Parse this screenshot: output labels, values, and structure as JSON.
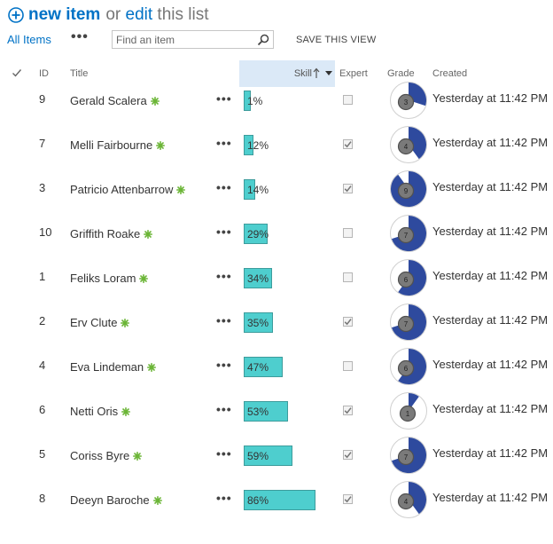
{
  "toolbar": {
    "new_item": "new item",
    "or_text": "or",
    "edit_link": "edit",
    "tail_text": "this list"
  },
  "view": {
    "all_items": "All Items",
    "more": "•••",
    "search_placeholder": "Find an item",
    "save_view": "SAVE THIS VIEW"
  },
  "columns": {
    "id": "ID",
    "title": "Title",
    "skill": "Skill",
    "expert": "Expert",
    "grade": "Grade",
    "created": "Created"
  },
  "colors": {
    "accent": "#0072c6",
    "skill_bar": "#4ecece",
    "grade_fill": "#2e4a9e",
    "new_badge": "#6bb536"
  },
  "rows": [
    {
      "id": "9",
      "title": "Gerald Scalera",
      "skill": 1,
      "skill_label": "1%",
      "expert": false,
      "grade": 3,
      "created": "Yesterday at 11:42 PM"
    },
    {
      "id": "7",
      "title": "Melli Fairbourne",
      "skill": 12,
      "skill_label": "12%",
      "expert": true,
      "grade": 4,
      "created": "Yesterday at 11:42 PM"
    },
    {
      "id": "3",
      "title": "Patricio Attenbarrow",
      "skill": 14,
      "skill_label": "14%",
      "expert": true,
      "grade": 9,
      "created": "Yesterday at 11:42 PM"
    },
    {
      "id": "10",
      "title": "Griffith Roake",
      "skill": 29,
      "skill_label": "29%",
      "expert": false,
      "grade": 7,
      "created": "Yesterday at 11:42 PM"
    },
    {
      "id": "1",
      "title": "Feliks Loram",
      "skill": 34,
      "skill_label": "34%",
      "expert": false,
      "grade": 6,
      "created": "Yesterday at 11:42 PM"
    },
    {
      "id": "2",
      "title": "Erv Clute",
      "skill": 35,
      "skill_label": "35%",
      "expert": true,
      "grade": 7,
      "created": "Yesterday at 11:42 PM"
    },
    {
      "id": "4",
      "title": "Eva Lindeman",
      "skill": 47,
      "skill_label": "47%",
      "expert": false,
      "grade": 6,
      "created": "Yesterday at 11:42 PM"
    },
    {
      "id": "6",
      "title": "Netti Oris",
      "skill": 53,
      "skill_label": "53%",
      "expert": true,
      "grade": 1,
      "created": "Yesterday at 11:42 PM"
    },
    {
      "id": "5",
      "title": "Coriss Byre",
      "skill": 59,
      "skill_label": "59%",
      "expert": true,
      "grade": 7,
      "created": "Yesterday at 11:42 PM"
    },
    {
      "id": "8",
      "title": "Deeyn Baroche",
      "skill": 86,
      "skill_label": "86%",
      "expert": true,
      "grade": 4,
      "created": "Yesterday at 11:42 PM"
    }
  ]
}
